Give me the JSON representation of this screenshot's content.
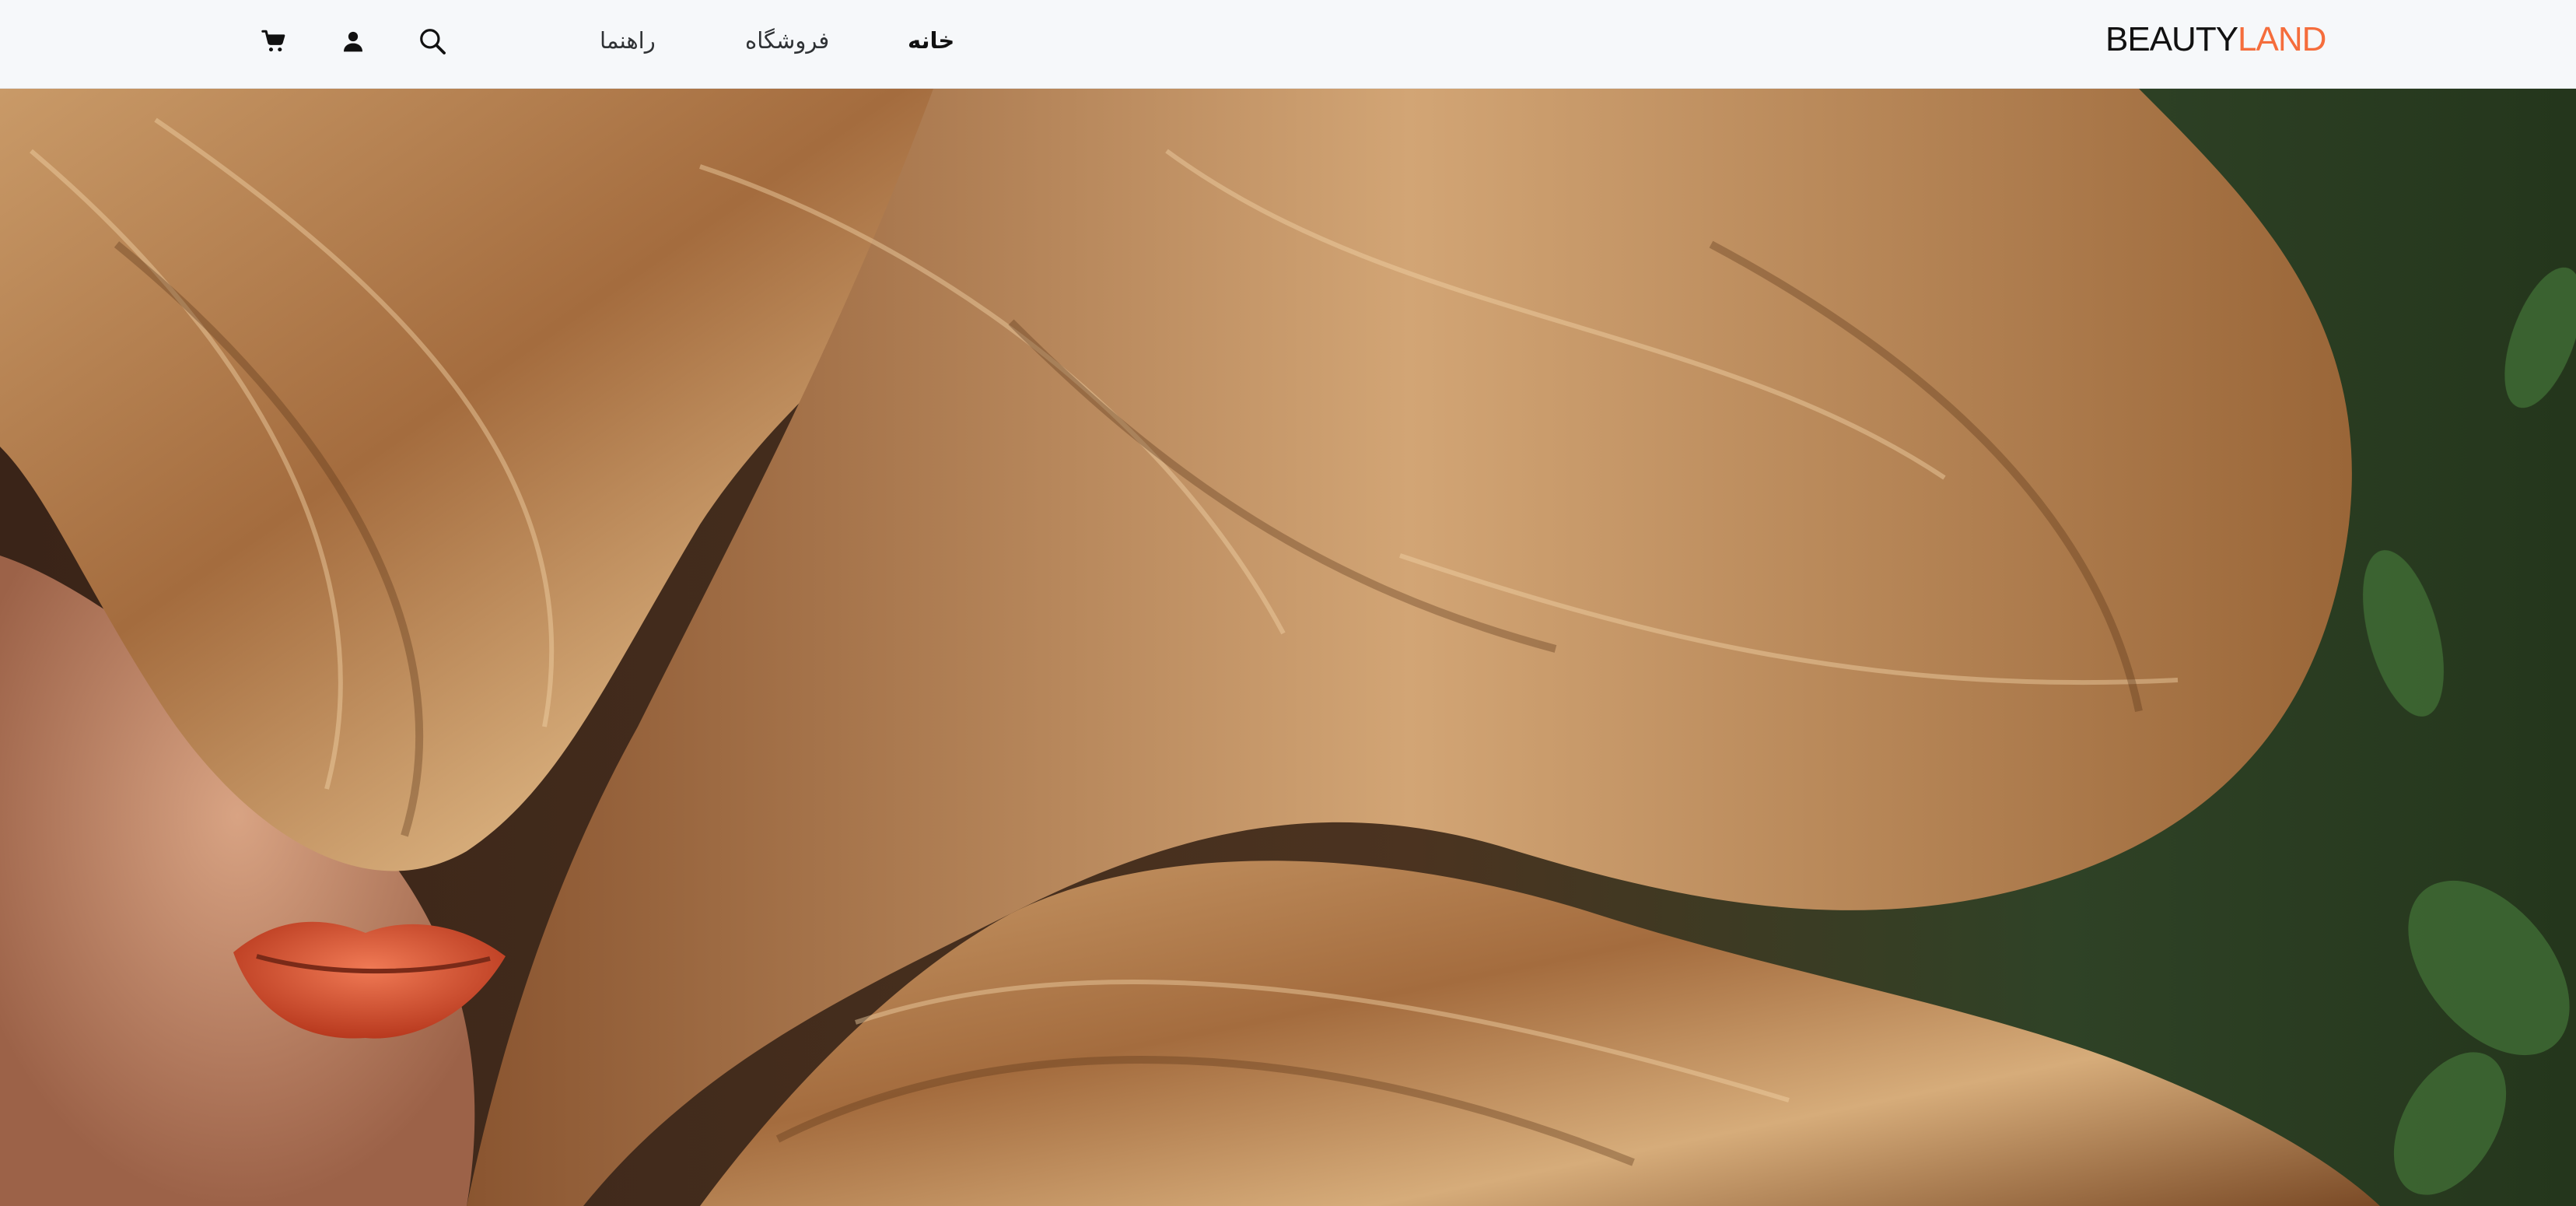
{
  "brand": {
    "part1": "BEAUTY",
    "part2": "LAND"
  },
  "nav": {
    "home": "خانه",
    "shop": "فروشگاه",
    "guide": "راهنما"
  },
  "icons": {
    "cart": "cart-icon",
    "user": "user-icon",
    "search": "search-icon"
  },
  "colors": {
    "nav_bg": "#f6f8fa",
    "brand_dark": "#111111",
    "brand_accent": "#f56d3c"
  },
  "hero": {
    "image": "hero-hair-model-image"
  }
}
